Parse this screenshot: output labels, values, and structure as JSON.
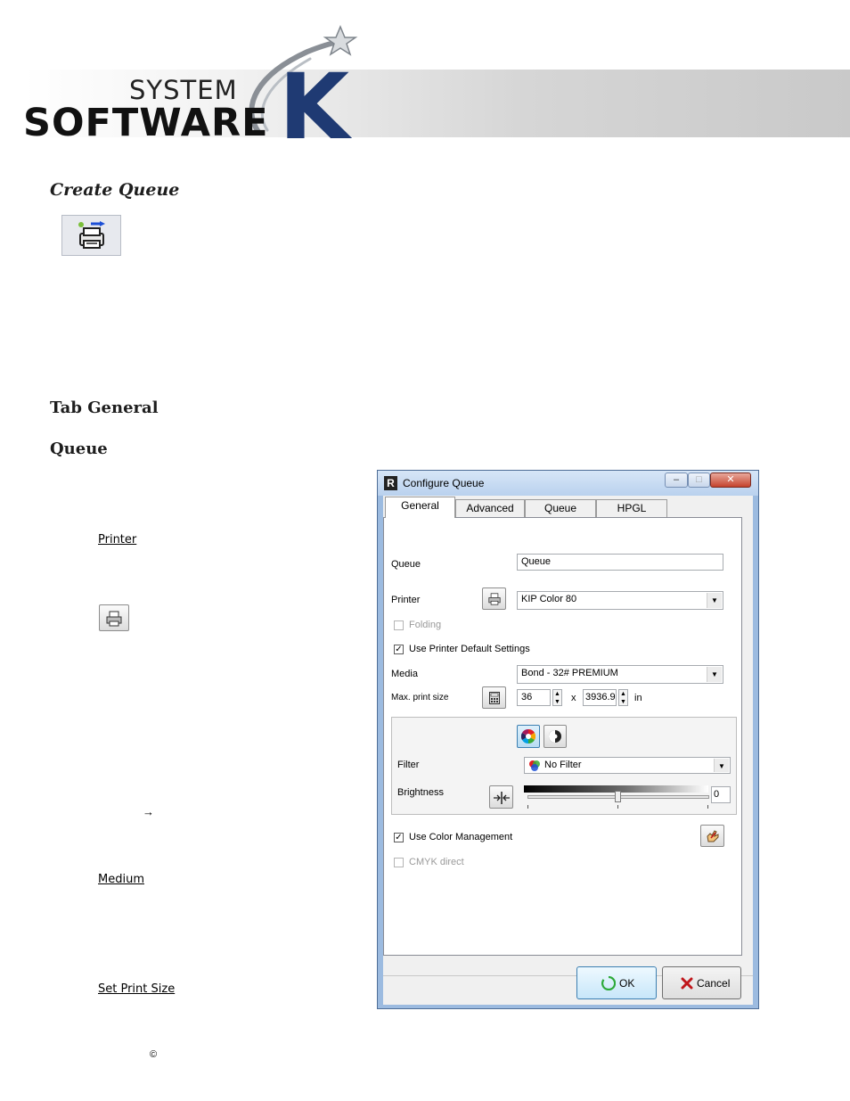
{
  "header": {
    "logo_system": "SYSTEM",
    "logo_software": "SOFTWARE",
    "logo_k": "K"
  },
  "doc": {
    "heading_create_queue": "Create Queue",
    "heading_tab_general": "Tab General",
    "heading_queue": "Queue",
    "label_printer": "Printer",
    "label_medium": "Medium",
    "label_set_print_size": "Set Print Size",
    "arrow_glyph": "→",
    "footer_copyright": "©"
  },
  "dialog": {
    "title": "Configure Queue",
    "app_icon_letter": "R",
    "tabs": [
      {
        "label": "General",
        "active": true
      },
      {
        "label": "Advanced",
        "active": false
      },
      {
        "label": "Queue",
        "active": false
      },
      {
        "label": "HPGL",
        "active": false
      }
    ],
    "queue_label": "Queue",
    "queue_value": "Queue",
    "printer_label": "Printer",
    "printer_value": "KIP Color 80",
    "folding_label": "Folding",
    "folding_checked": false,
    "use_default_label": "Use Printer Default Settings",
    "use_default_checked": true,
    "media_label": "Media",
    "media_value": "Bond - 32# PREMIUM",
    "max_print_size_label": "Max. print size",
    "width_value": "36",
    "times": "x",
    "height_value": "3936.9",
    "unit": "in",
    "filter_label": "Filter",
    "filter_value": "No Filter",
    "brightness_label": "Brightness",
    "brightness_value": "0",
    "use_color_mgmt_label": "Use Color Management",
    "use_color_mgmt_checked": true,
    "cmyk_direct_label": "CMYK direct",
    "cmyk_direct_checked": false,
    "ok_label": "OK",
    "cancel_label": "Cancel"
  },
  "colors": {
    "logo_k": "#1f3a73",
    "dialog_frame": "#9cbbe0",
    "cancel_x": "#c0161b",
    "ok_ring": "#2eaa3a"
  }
}
